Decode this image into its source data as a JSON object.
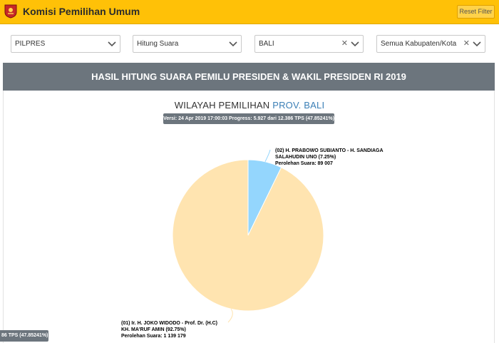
{
  "header": {
    "title": "Komisi Pemilihan Umum",
    "reset_label": "Reset Filter",
    "colors": {
      "bar": "#ffc107"
    }
  },
  "filters": [
    {
      "value": "PILPRES",
      "clearable": false
    },
    {
      "value": "Hitung Suara",
      "clearable": false
    },
    {
      "value": "BALI",
      "clearable": true
    },
    {
      "value": "Semua Kabupaten/Kota",
      "clearable": true
    }
  ],
  "section_title": "HASIL HITUNG SUARA PEMILU PRESIDEN & WAKIL PRESIDEN RI 2019",
  "region": {
    "prefix": "WILAYAH PEMILIHAN",
    "name": "PROV. BALI"
  },
  "version_badge": "Versi: 24 Apr 2019 17:00:03 Progress: 5.927 dari 12.386 TPS (47.85241%)",
  "bottom_badge": "86 TPS (47.85241%)",
  "chart_data": {
    "type": "pie",
    "slices": [
      {
        "label_lines": [
          "(01) Ir. H. JOKO WIDODO - Prof. Dr. (H.C)",
          "KH. MA'RUF AMIN (92.75%)",
          "Perolehan Suara: 1 139 179"
        ],
        "percent": 92.75,
        "votes": 1139179,
        "color": "#ffe4b0"
      },
      {
        "label_lines": [
          "(02) H. PRABOWO SUBIANTO - H. SANDIAGA",
          "SALAHUDIN UNO (7.25%)",
          "Perolehan Suara: 89 007"
        ],
        "percent": 7.25,
        "votes": 89007,
        "color": "#94d6fd"
      }
    ]
  }
}
